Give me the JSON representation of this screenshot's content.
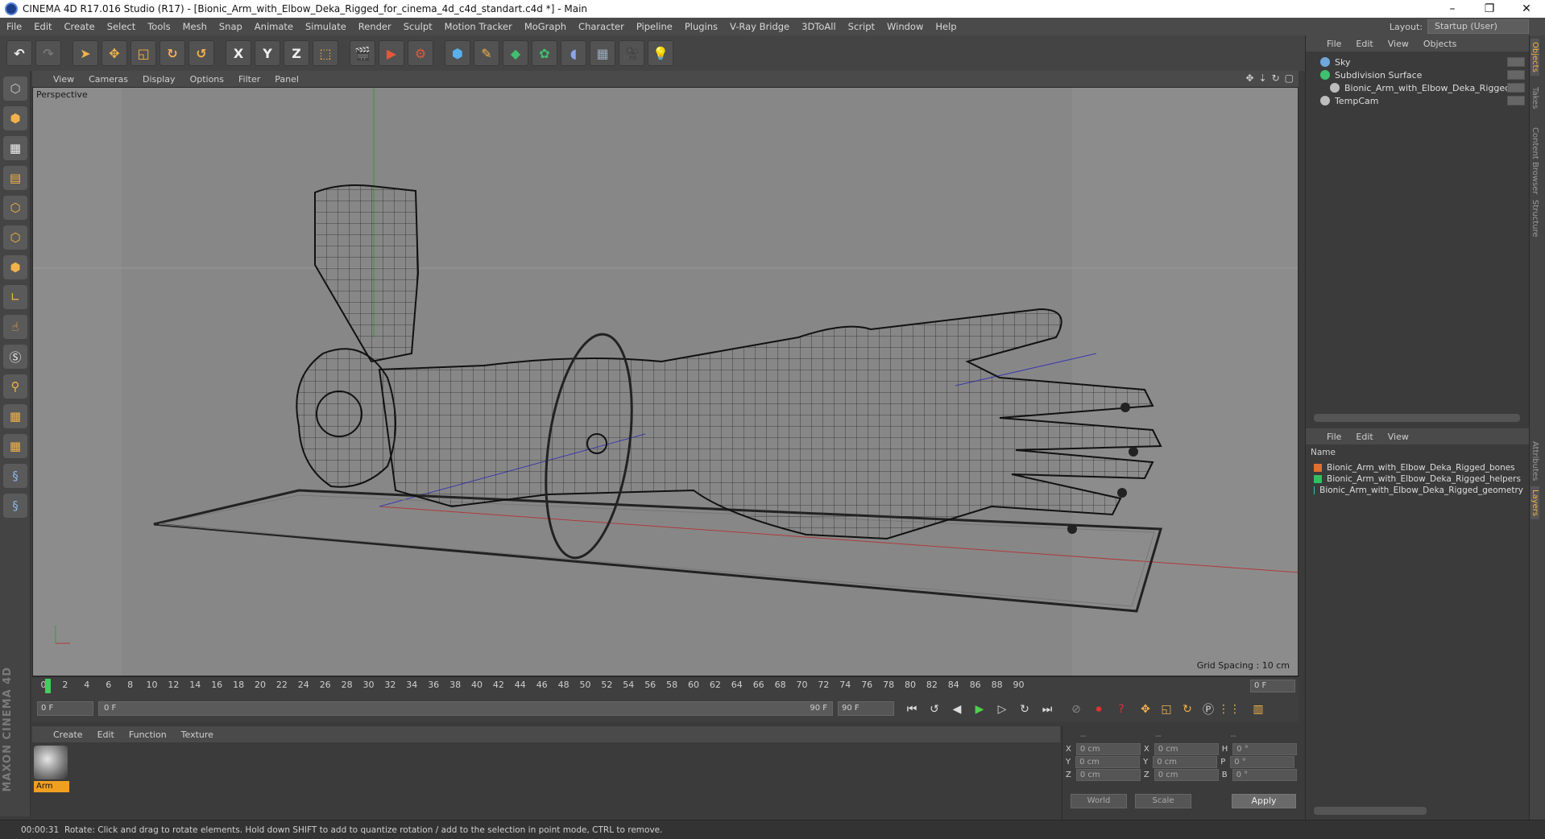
{
  "window": {
    "title": "CINEMA 4D R17.016 Studio (R17) - [Bionic_Arm_with_Elbow_Deka_Rigged_for_cinema_4d_c4d_standart.c4d *] - Main",
    "controls": [
      "–",
      "❐",
      "✕"
    ]
  },
  "menu": {
    "items": [
      "File",
      "Edit",
      "Create",
      "Select",
      "Tools",
      "Mesh",
      "Snap",
      "Animate",
      "Simulate",
      "Render",
      "Sculpt",
      "Motion Tracker",
      "MoGraph",
      "Character",
      "Pipeline",
      "Plugins",
      "V-Ray Bridge",
      "3DToAll",
      "Script",
      "Window",
      "Help"
    ],
    "layout_label": "Layout:",
    "layout_value": "Startup (User)"
  },
  "toolbar": {
    "axis_x": "X",
    "axis_y": "Y",
    "axis_z": "Z"
  },
  "viewport": {
    "menu": [
      "View",
      "Cameras",
      "Display",
      "Options",
      "Filter",
      "Panel"
    ],
    "label": "Perspective",
    "grid_spacing": "Grid Spacing : 10 cm"
  },
  "timeline": {
    "ticks": [
      "0",
      "2",
      "4",
      "6",
      "8",
      "10",
      "12",
      "14",
      "16",
      "18",
      "20",
      "22",
      "24",
      "26",
      "28",
      "30",
      "32",
      "34",
      "36",
      "38",
      "40",
      "42",
      "44",
      "46",
      "48",
      "50",
      "52",
      "54",
      "56",
      "58",
      "60",
      "62",
      "64",
      "66",
      "68",
      "70",
      "72",
      "74",
      "76",
      "78",
      "80",
      "82",
      "84",
      "86",
      "88",
      "90"
    ],
    "current_frame": "0 F"
  },
  "playback": {
    "start_field": "0 F",
    "slider_start": "0 F",
    "slider_end": "90 F",
    "end_field": "90 F"
  },
  "materials": {
    "menu": [
      "Create",
      "Edit",
      "Function",
      "Texture"
    ],
    "items": [
      {
        "name": "Arm"
      }
    ]
  },
  "coordinates": {
    "header": [
      "--",
      "--",
      "--"
    ],
    "rows": [
      {
        "a": "X",
        "av": "0 cm",
        "b": "X",
        "bv": "0 cm",
        "c": "H",
        "cv": "0 °"
      },
      {
        "a": "Y",
        "av": "0 cm",
        "b": "Y",
        "bv": "0 cm",
        "c": "P",
        "cv": "0 °"
      },
      {
        "a": "Z",
        "av": "0 cm",
        "b": "Z",
        "bv": "0 cm",
        "c": "B",
        "cv": "0 °"
      }
    ],
    "mode": "World",
    "scale": "Scale",
    "apply": "Apply"
  },
  "status": {
    "time": "00:00:31",
    "message": "Rotate: Click and drag to rotate elements. Hold down SHIFT to add to quantize rotation / add to the selection in point mode, CTRL to remove."
  },
  "object_manager": {
    "menu": [
      "File",
      "Edit",
      "View",
      "Objects"
    ],
    "objects": [
      {
        "name": "Sky",
        "color": "#6fa8dc"
      },
      {
        "name": "Subdivision Surface",
        "color": "#3fbf6f"
      },
      {
        "name": "Bionic_Arm_with_Elbow_Deka_Rigged",
        "color": "#bdbdbd"
      },
      {
        "name": "TempCam",
        "color": "#bdbdbd"
      }
    ]
  },
  "layer_manager": {
    "menu": [
      "File",
      "Edit",
      "View"
    ],
    "header": "Name",
    "layers": [
      {
        "name": "Bionic_Arm_with_Elbow_Deka_Rigged_bones",
        "color": "#e07030"
      },
      {
        "name": "Bionic_Arm_with_Elbow_Deka_Rigged_helpers",
        "color": "#30c060"
      },
      {
        "name": "Bionic_Arm_with_Elbow_Deka_Rigged_geometry",
        "color": "#30c0c0"
      }
    ]
  },
  "side_tabs": [
    "Objects",
    "Takes",
    "Content Browser",
    "Structure",
    "Attributes",
    "Layers"
  ],
  "branding": "MAXON CINEMA 4D"
}
